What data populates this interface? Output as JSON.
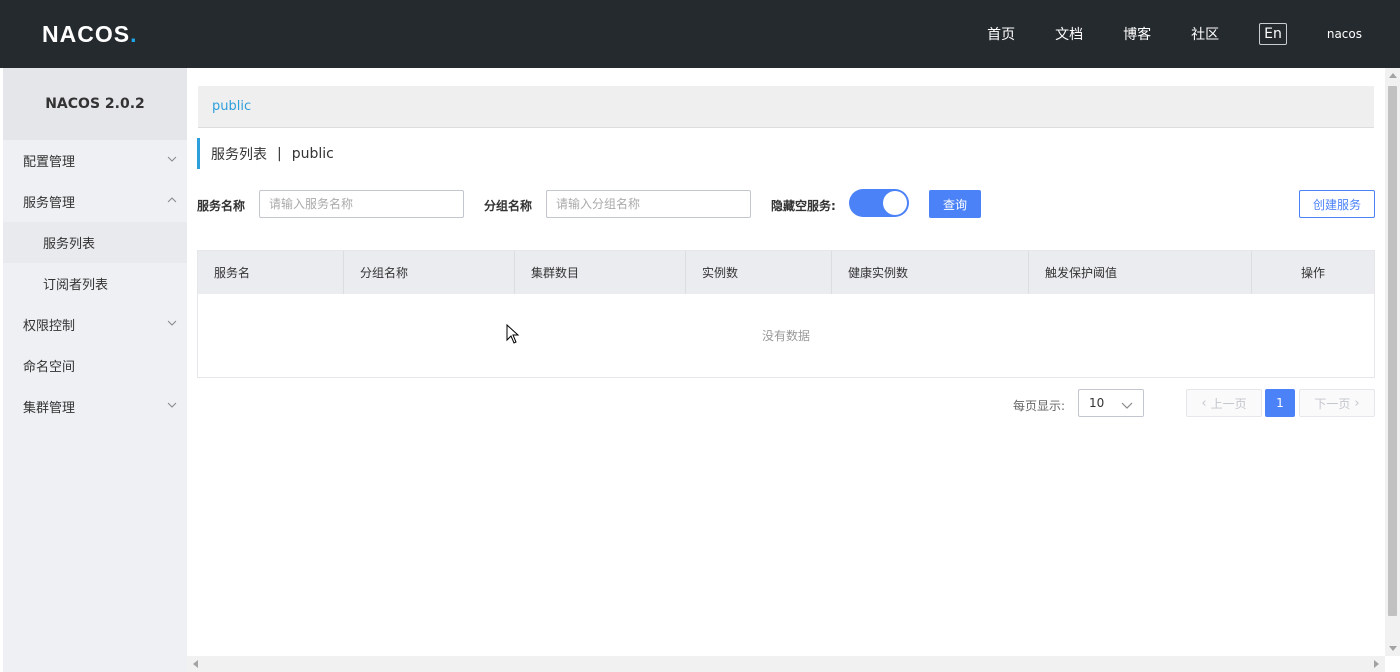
{
  "header": {
    "logo_main": "NACOS",
    "logo_dot": ".",
    "nav": [
      "首页",
      "文档",
      "博客",
      "社区"
    ],
    "lang": "En",
    "user": "nacos"
  },
  "sidebar": {
    "brand": "NACOS 2.0.2",
    "items": [
      {
        "label": "配置管理",
        "chevron": "down"
      },
      {
        "label": "服务管理",
        "chevron": "up"
      },
      {
        "label": "服务列表",
        "sub": true,
        "active": true
      },
      {
        "label": "订阅者列表",
        "sub": true
      },
      {
        "label": "权限控制",
        "chevron": "down"
      },
      {
        "label": "命名空间"
      },
      {
        "label": "集群管理",
        "chevron": "down"
      }
    ]
  },
  "main": {
    "namespace": "public",
    "title": "服务列表",
    "title_sep": "|",
    "title_ns": "public",
    "filter": {
      "service_label": "服务名称",
      "service_placeholder": "请输入服务名称",
      "group_label": "分组名称",
      "group_placeholder": "请输入分组名称",
      "hide_empty_label": "隐藏空服务:",
      "hide_empty_on": true,
      "query_button": "查询",
      "create_button": "创建服务"
    },
    "table": {
      "columns": [
        "服务名",
        "分组名称",
        "集群数目",
        "实例数",
        "健康实例数",
        "触发保护阈值",
        "操作"
      ],
      "empty_text": "没有数据"
    },
    "pager": {
      "page_size_label": "每页显示:",
      "page_size": "10",
      "prev": "上一页",
      "current": "1",
      "next": "下一页"
    }
  },
  "colors": {
    "topbar": "#252a2f",
    "primary": "#4b82f7",
    "accent": "#2d9fdb"
  }
}
